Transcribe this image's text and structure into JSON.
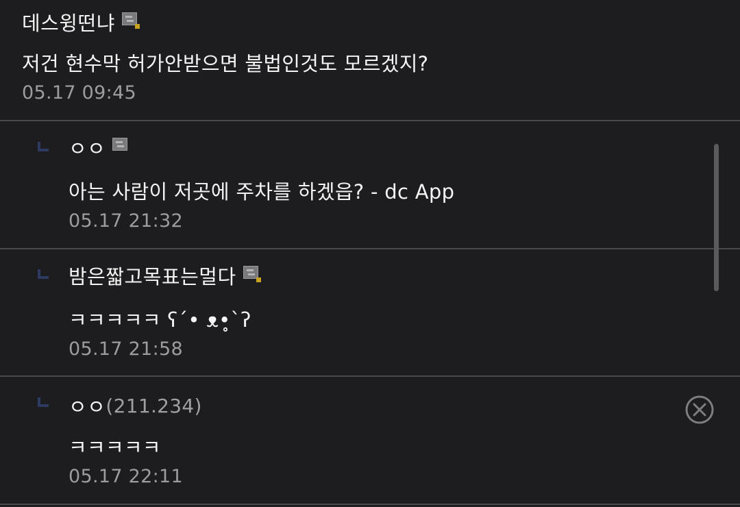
{
  "comments": [
    {
      "nickname": "데스윙떤냐",
      "text": "저건 현수막 허가안받으면 불법인것도 모르겠지?",
      "time": "05.17 09:45"
    },
    {
      "nickname": "ㅇㅇ",
      "text": "아는 사람이 저곳에 주차를 하겠읍? - dc App",
      "time": "05.17 21:32"
    },
    {
      "nickname": "밤은짧고목표는멀다",
      "text": "ㅋㅋㅋㅋㅋ ʕ´• ᴥ•̥`ʔ",
      "time": "05.17 21:58"
    },
    {
      "nickname": "ㅇㅇ",
      "ip": "(211.234)",
      "text": "ㅋㅋㅋㅋㅋ",
      "time": "05.17 22:11"
    }
  ],
  "icons": {
    "member_badge": "gallery-member-badge-icon",
    "reply_arrow": "reply-arrow-icon",
    "delete": "delete-circle-x-icon"
  },
  "colors": {
    "background": "#1d1d1f",
    "text": "#f4f4f4",
    "meta": "#9d9da1",
    "divider": "#4a4a4c",
    "reply_arrow": "#2d3a63",
    "badge_accent": "#c8a21e"
  }
}
